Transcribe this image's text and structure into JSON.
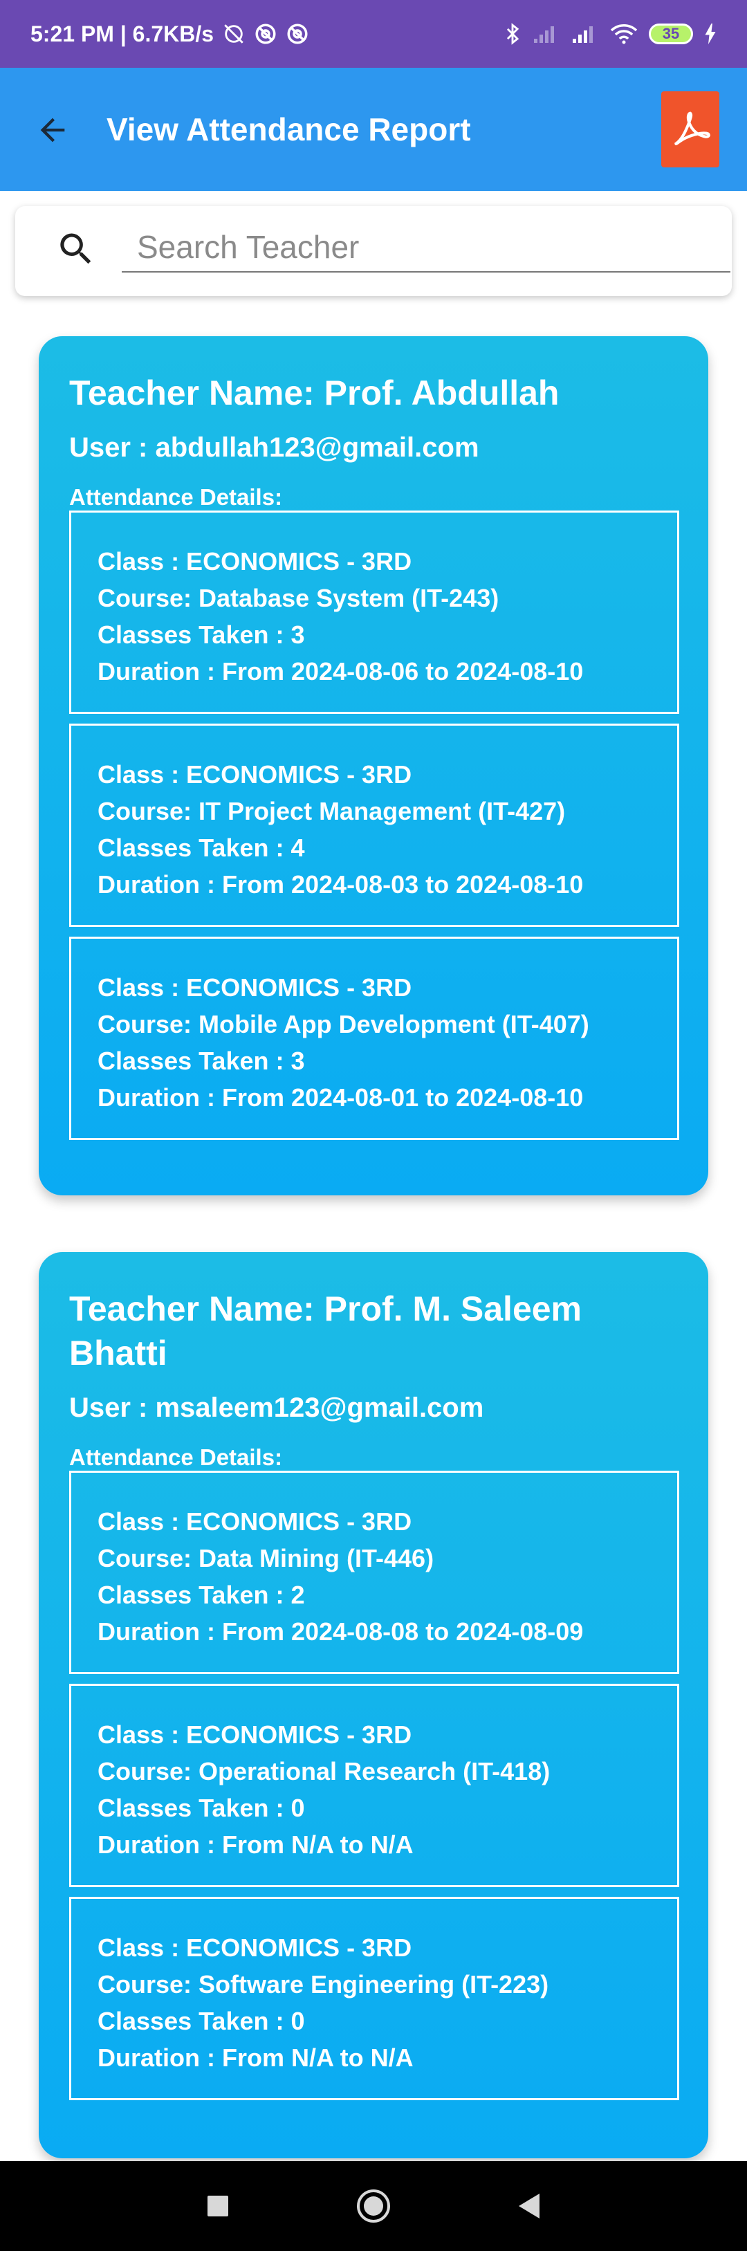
{
  "status_bar": {
    "time_speed": "5:21 PM | 6.7KB/s",
    "battery": "35",
    "icons": [
      "alarm-off-icon",
      "sync-icon",
      "sync-icon",
      "bluetooth-icon",
      "signal-icon",
      "signal-icon",
      "wifi-icon",
      "battery-icon",
      "charging-icon"
    ]
  },
  "app_bar": {
    "title": "View Attendance Report",
    "back_icon": "arrow-back-icon",
    "pdf_icon": "pdf-icon"
  },
  "search": {
    "placeholder": "Search Teacher",
    "value": ""
  },
  "teachers": [
    {
      "name": "Teacher Name: Prof. Abdullah",
      "user": "User : abdullah123@gmail.com",
      "details_label": "Attendance Details:",
      "records": [
        {
          "class": "Class : ECONOMICS - 3RD",
          "course": "Course: Database System (IT-243)",
          "taken": "Classes Taken : 3",
          "duration": "Duration : From 2024-08-06 to 2024-08-10"
        },
        {
          "class": "Class : ECONOMICS - 3RD",
          "course": "Course: IT Project Management (IT-427)",
          "taken": "Classes Taken : 4",
          "duration": "Duration : From 2024-08-03 to 2024-08-10"
        },
        {
          "class": "Class : ECONOMICS - 3RD",
          "course": "Course: Mobile App Development (IT-407)",
          "taken": "Classes Taken : 3",
          "duration": "Duration : From 2024-08-01 to 2024-08-10"
        }
      ]
    },
    {
      "name": "Teacher Name: Prof. M. Saleem Bhatti",
      "user": "User : msaleem123@gmail.com",
      "details_label": "Attendance Details:",
      "records": [
        {
          "class": "Class : ECONOMICS - 3RD",
          "course": "Course: Data Mining (IT-446)",
          "taken": "Classes Taken : 2",
          "duration": "Duration : From 2024-08-08 to 2024-08-09"
        },
        {
          "class": "Class : ECONOMICS - 3RD",
          "course": "Course: Operational Research (IT-418)",
          "taken": "Classes Taken : 0",
          "duration": "Duration : From N/A to N/A"
        },
        {
          "class": "Class : ECONOMICS - 3RD",
          "course": "Course: Software Engineering (IT-223)",
          "taken": "Classes Taken : 0",
          "duration": "Duration : From N/A to N/A"
        }
      ]
    }
  ],
  "nav_bar": {
    "icons": [
      "recents-square-icon",
      "home-circle-icon",
      "back-triangle-icon"
    ]
  },
  "colors": {
    "status_bar": "#6a49b2",
    "app_bar": "#2d97ef",
    "card_top": "#1cbce6",
    "card_bottom": "#0aabf3",
    "pdf": "#f0542b"
  }
}
